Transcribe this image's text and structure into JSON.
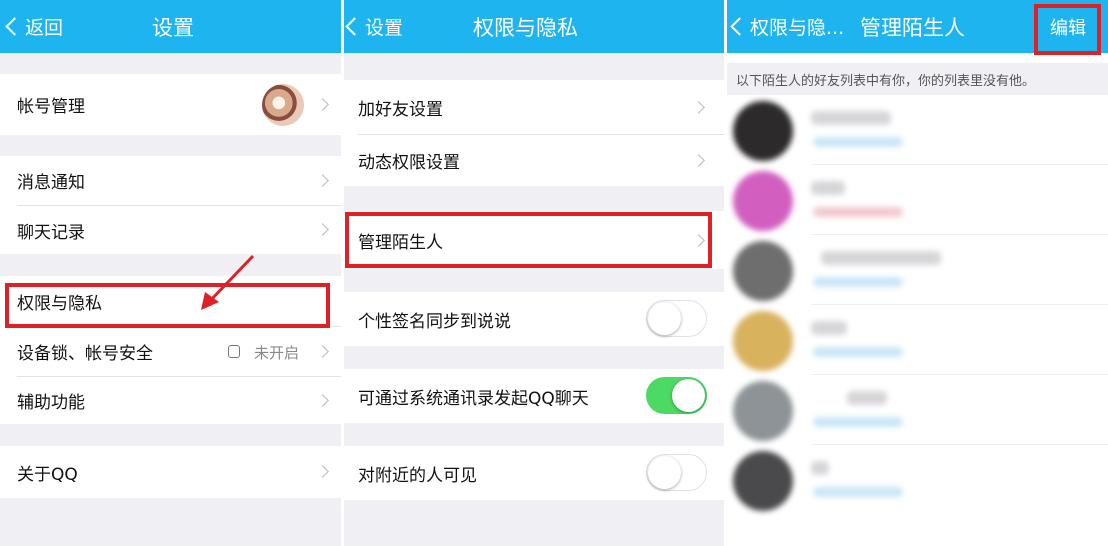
{
  "settings": {
    "back_label": "返回",
    "title": "设置",
    "items": {
      "account": "帐号管理",
      "notifications": "消息通知",
      "chat_history": "聊天记录",
      "privacy": "权限与隐私",
      "device_lock": "设备锁、帐号安全",
      "device_lock_status": "未开启",
      "accessibility": "辅助功能",
      "about": "关于QQ"
    }
  },
  "privacy": {
    "back_label": "设置",
    "title": "权限与隐私",
    "items": {
      "add_friend": "加好友设置",
      "moments": "动态权限设置",
      "strangers": "管理陌生人",
      "signature_sync": "个性签名同步到说说",
      "contacts_chat": "可通过系统通讯录发起QQ聊天",
      "nearby_visible": "对附近的人可见"
    },
    "toggles": {
      "signature_sync": false,
      "contacts_chat": true,
      "nearby_visible": false
    }
  },
  "strangers": {
    "back_label": "权限与隐...",
    "title": "管理陌生人",
    "edit_label": "编辑",
    "notice": "以下陌生人的好友列表中有你，你的列表里没有他。"
  },
  "colors": {
    "header": "#1eb4ef",
    "highlight": "#e02027",
    "toggle_on": "#4cd964"
  }
}
